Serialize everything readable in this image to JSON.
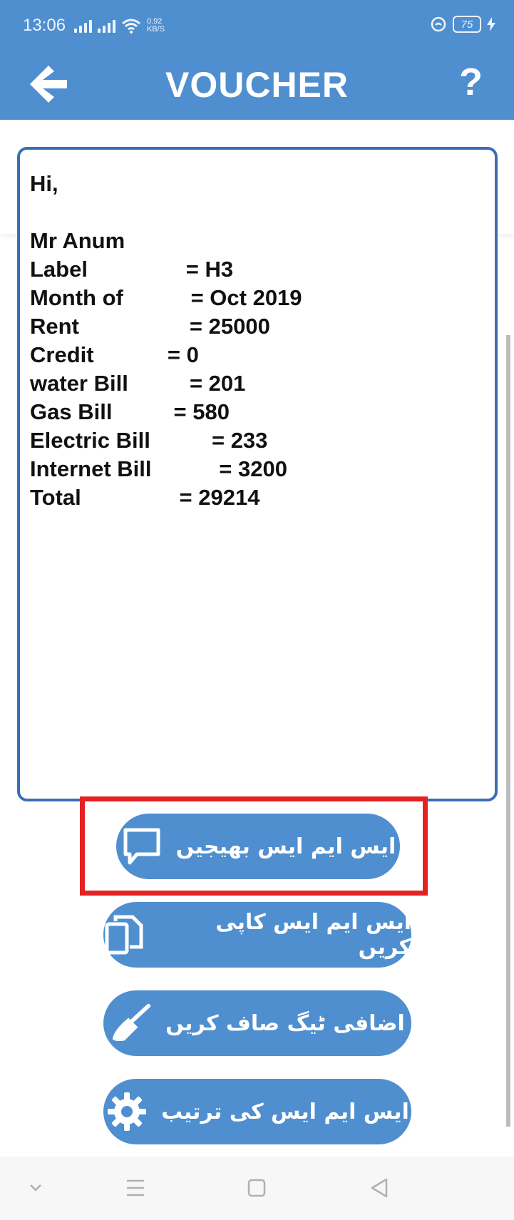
{
  "status_bar": {
    "time": "13:06",
    "network_speed_value": "0.92",
    "network_speed_unit": "KB/S",
    "battery_level": "75"
  },
  "app_bar": {
    "title": "VOUCHER",
    "help_label": "?"
  },
  "message": {
    "text": "Hi,\n\nMr Anum\nLabel                = H3\nMonth of           = Oct 2019\nRent                  = 25000\nCredit            = 0\nwater Bill          = 201\nGas Bill          = 580\nElectric Bill          = 233\nInternet Bill           = 3200\nTotal                = 29214"
  },
  "buttons": {
    "send_sms": "ایس ایم ایس بھیجیں",
    "copy_sms": "ایس ایم ایس کاپی کریں",
    "clear_tags": "اضافی ٹیگ صاف کریں",
    "sms_settings": "ایس ایم ایس کی ترتیب"
  },
  "icons": {
    "back": "arrow-left-icon",
    "send": "chat-bubble-icon",
    "copy": "copy-icon",
    "clear": "broom-icon",
    "settings": "gear-icon"
  },
  "colors": {
    "primary": "#4f8fd0",
    "border": "#3a6eb7",
    "highlight": "#e52222"
  }
}
